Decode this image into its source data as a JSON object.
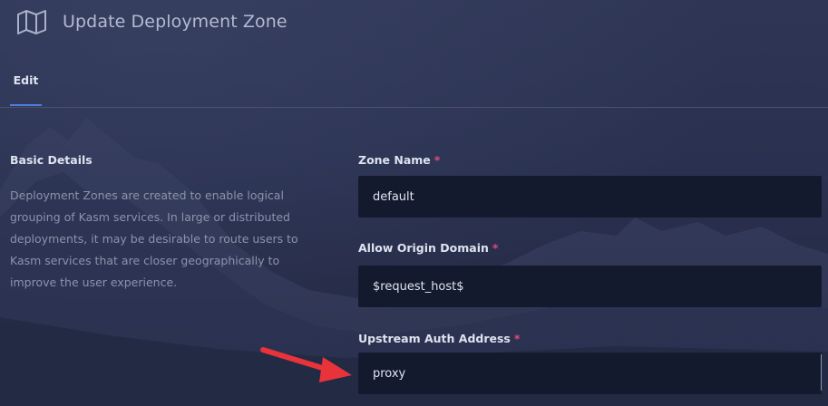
{
  "header": {
    "title": "Update Deployment Zone",
    "icon": "map-icon"
  },
  "tabs": [
    {
      "label": "Edit",
      "active": true
    }
  ],
  "basic_details": {
    "title": "Basic Details",
    "description": "Deployment Zones are created to enable logical grouping of Kasm services. In large or distributed deployments, it may be desirable to route users to Kasm services that are closer geographically to improve the user experience."
  },
  "form": {
    "zone_name": {
      "label": "Zone Name",
      "required_mark": "*",
      "value": "default"
    },
    "allow_origin_domain": {
      "label": "Allow Origin Domain",
      "required_mark": "*",
      "value": "$request_host$"
    },
    "upstream_auth_address": {
      "label": "Upstream Auth Address",
      "required_mark": "*",
      "value": "proxy"
    }
  },
  "colors": {
    "background": "#2c3350",
    "input_background": "#141a2e",
    "tab_underline": "#4e7fe0",
    "required": "#e04a78",
    "annotation_arrow": "#e8333a"
  }
}
